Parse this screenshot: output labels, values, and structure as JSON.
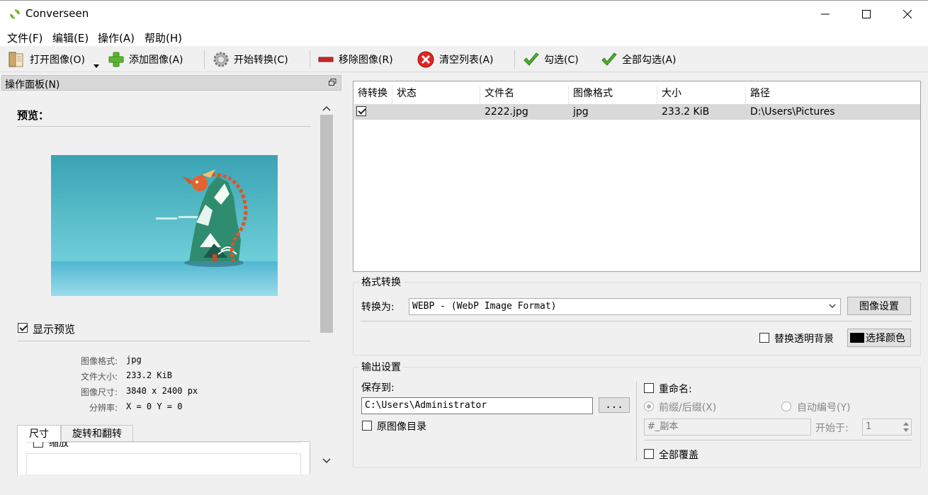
{
  "window": {
    "title": "Converseen"
  },
  "menu": [
    "文件(F)",
    "编辑(E)",
    "操作(A)",
    "帮助(H)"
  ],
  "toolbar": {
    "open": "打开图像(O)",
    "add": "添加图像(A)",
    "convert": "开始转换(C)",
    "remove": "移除图像(R)",
    "clear": "清空列表(A)",
    "check": "勾选(C)",
    "check_all": "全部勾选(A)"
  },
  "panel": {
    "title": "操作面板(N)",
    "preview_heading": "预览：",
    "show_preview": "显示预览",
    "info": {
      "format_label": "图像格式:",
      "format_value": "jpg",
      "size_label": "文件大小:",
      "size_value": "233.2 KiB",
      "dim_label": "图像尺寸:",
      "dim_value": "3840 x 2400 px",
      "res_label": "分辨率:",
      "res_value": "X = 0 Y = 0"
    },
    "tabs": [
      "尺寸",
      "旋转和翻转"
    ],
    "scale_label": "缩放"
  },
  "table": {
    "columns": [
      "待转换",
      "状态",
      "文件名",
      "图像格式",
      "大小",
      "路径"
    ],
    "rows": [
      {
        "checked": true,
        "status": "",
        "filename": "2222.jpg",
        "format": "jpg",
        "size": "233.2 KiB",
        "path": "D:\\Users\\Pictures"
      }
    ]
  },
  "format_group": {
    "title": "格式转换",
    "convert_to_label": "转换为:",
    "format_selected": "WEBP - (WebP Image Format)",
    "image_settings": "图像设置",
    "replace_bg": "替换透明背景",
    "choose_color": "选择颜色",
    "bg_color": "#000000"
  },
  "output_group": {
    "title": "输出设置",
    "save_to_label": "保存到:",
    "save_path": "C:\\Users\\Administrator",
    "browse": "...",
    "original_dir": "原图像目录",
    "rename": "重命名:",
    "prefix_suffix": "前缀/后缀(X)",
    "auto_number": "自动编号(Y)",
    "name_pattern": "#_副本",
    "start_at_label": "开始于:",
    "start_at_value": "1",
    "overwrite_all": "全部覆盖"
  }
}
